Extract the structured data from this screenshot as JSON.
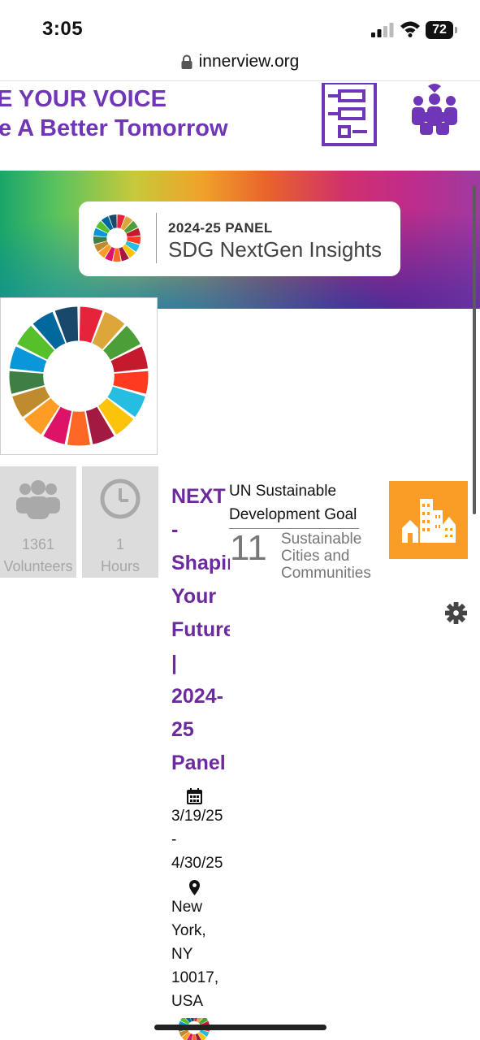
{
  "status_bar": {
    "time": "3:05",
    "battery": "72",
    "signal_icon": "cellular-signal-icon",
    "wifi_icon": "wifi-icon"
  },
  "browser": {
    "url": "innerview.org",
    "lock_icon": "lock-icon"
  },
  "banner": {
    "line1": "E YOUR VOICE",
    "line2": "e A Better Tomorrow",
    "accent_color": "#6f36b8",
    "icons": [
      "survey-checklist-icon",
      "community-people-icon"
    ]
  },
  "panel_card": {
    "panel_label": "2024-25  PANEL",
    "title": "SDG NextGen Insights"
  },
  "stats": {
    "volunteers": {
      "value": "1361",
      "label": "Volunteers",
      "icon": "people-group-icon"
    },
    "hours": {
      "value": "1",
      "label": "Hours",
      "icon": "clock-icon"
    }
  },
  "event": {
    "title_lines": [
      "NEXT",
      "-",
      "Shapin",
      "Your",
      "Future",
      "|",
      "2024-",
      "25",
      "Panel"
    ],
    "title_color": "#6c2a9e",
    "date_lines": [
      "3/19/25",
      "-",
      "4/30/25"
    ],
    "location_lines": [
      "New",
      "York,",
      "NY",
      "10017,",
      "USA"
    ],
    "calendar_icon": "calendar-icon",
    "location_icon": "map-pin-icon"
  },
  "un_goal": {
    "heading_line1": "UN Sustainable",
    "heading_line2": "Development Goal",
    "number": "11",
    "name": "Sustainable Cities and Communities",
    "tile_color": "#f99d26",
    "tile_icon": "city-buildings-icon"
  },
  "settings_icon": "gear-icon"
}
